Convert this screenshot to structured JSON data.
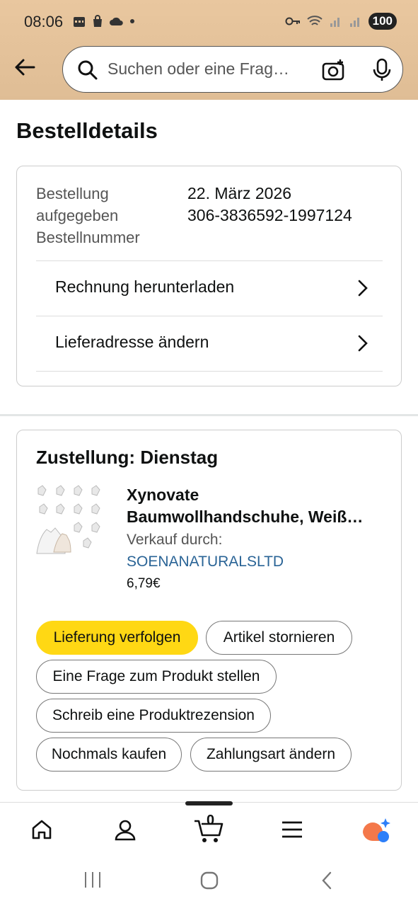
{
  "status": {
    "time": "08:06",
    "battery": "100"
  },
  "search": {
    "placeholder": "Suchen oder eine Frag…"
  },
  "page": {
    "title": "Bestelldetails"
  },
  "order": {
    "labels": [
      "Bestellung",
      "aufgegeben",
      "Bestellnummer"
    ],
    "date": "22. März 2026",
    "number": "306-3836592-1997124"
  },
  "actions": {
    "invoice": "Rechnung herunterladen",
    "address": "Lieferadresse ändern"
  },
  "delivery": {
    "title": "Zustellung: Dienstag",
    "product_line1": "Xynovate",
    "product_line2": "Baumwollhandschuhe, Weiß…",
    "sold_by_label": "Verkauf durch:",
    "seller": "SOENANATURALSLTD",
    "price": "6,79€"
  },
  "buttons": {
    "track": "Lieferung verfolgen",
    "cancel": "Artikel stornieren",
    "ask": "Eine Frage zum Produkt stellen",
    "review": "Schreib eine Produktrezension",
    "buy_again": "Nochmals kaufen",
    "payment": "Zahlungsart ändern"
  },
  "nav": {
    "cart_count": "0"
  },
  "colors": {
    "header": "#e9c79f",
    "primary_button": "#ffd814",
    "link": "#2a6496"
  }
}
